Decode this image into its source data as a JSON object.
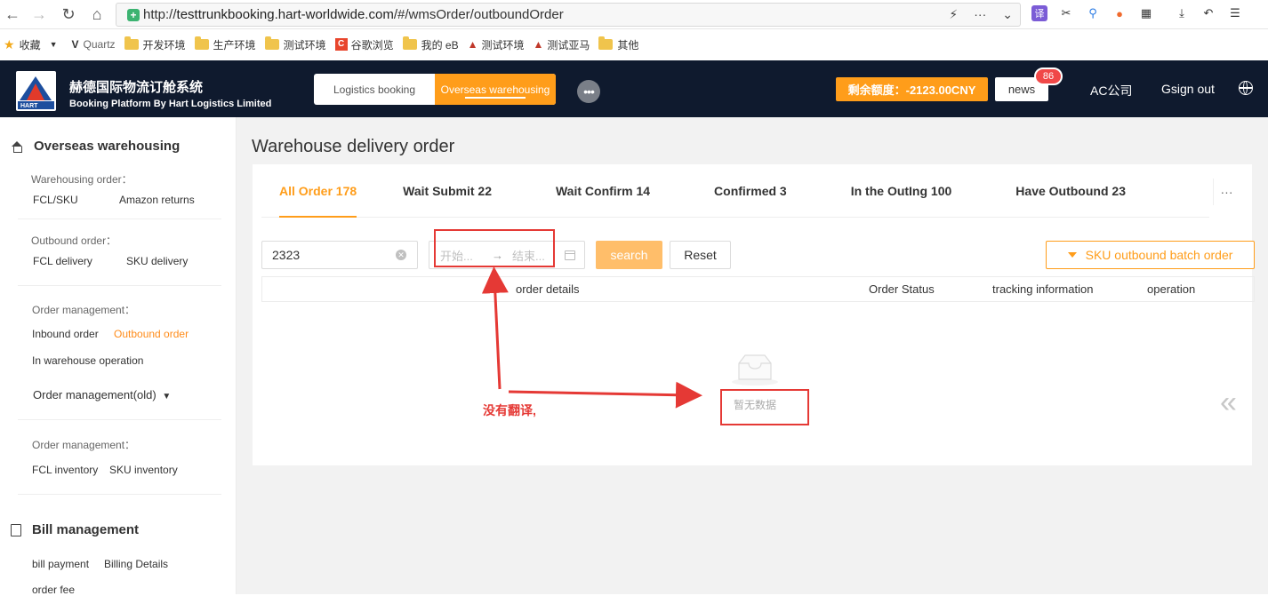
{
  "browser": {
    "url_scheme": "http://",
    "url_host": "testtrunkbooking.hart-worldwide.com",
    "url_path": "/#/wmsOrder/outboundOrder",
    "bookmarks": [
      "收藏",
      "Quartz",
      "开发环境",
      "生产环境",
      "测试环境",
      "谷歌浏览",
      "我的 eB",
      "测试环境",
      "测试亚马",
      "其他"
    ]
  },
  "header": {
    "brand_cn": "赫德国际物流订舱系统",
    "brand_en": "Booking Platform By Hart Logistics Limited",
    "logo_text": "HART",
    "modes": [
      "Logistics booking",
      "Overseas warehousing"
    ],
    "active_mode": "Overseas warehousing",
    "balance": "剩余额度：-2123.00CNY",
    "news_label": "news",
    "news_count": "86",
    "company": "AC公司",
    "signout": "Gsign out"
  },
  "sidebar": {
    "title": "Overseas warehousing",
    "sections": {
      "warehousing_label": "Warehousing order：",
      "fcl_sku": "FCL/SKU",
      "amazon_returns": "Amazon returns",
      "outbound_label": "Outbound order：",
      "fcl_delivery": "FCL delivery",
      "sku_delivery": "SKU delivery",
      "order_mgmt_label": "Order management：",
      "inbound_order": "Inbound order",
      "outbound_order": "Outbound order",
      "in_warehouse_operation": "In warehouse operation",
      "order_mgmt_old": "Order management(old)",
      "order_mgmt_label2": "Order management：",
      "fcl_inventory": "FCL inventory",
      "sku_inventory": "SKU inventory",
      "bill_management": "Bill management",
      "bill_payment": "bill payment",
      "billing_details": "Billing Details",
      "order_fee": "order fee"
    }
  },
  "main": {
    "page_title": "Warehouse delivery order",
    "tabs": [
      {
        "label": "All Order 178",
        "active": true
      },
      {
        "label": "Wait Submit 22",
        "active": false
      },
      {
        "label": "Wait Confirm 14",
        "active": false
      },
      {
        "label": "Confirmed 3",
        "active": false
      },
      {
        "label": "In the OutIng 100",
        "active": false
      },
      {
        "label": "Have Outbound 23",
        "active": false
      }
    ],
    "tab_more": "···",
    "search_value": "2323",
    "date_start_placeholder": "开始...",
    "date_arrow": "→",
    "date_end_placeholder": "结束...",
    "search_button": "search",
    "reset_button": "Reset",
    "batch_button": "SKU outbound batch order",
    "columns": [
      "order details",
      "Order Status",
      "tracking information",
      "operation"
    ],
    "empty_text": "暂无数据",
    "collapse": "«"
  },
  "annotation": {
    "note": "没有翻译,"
  },
  "colors": {
    "accent": "#ff9d1a",
    "header_bg": "#0f1a2e",
    "annotation": "#e53935"
  }
}
